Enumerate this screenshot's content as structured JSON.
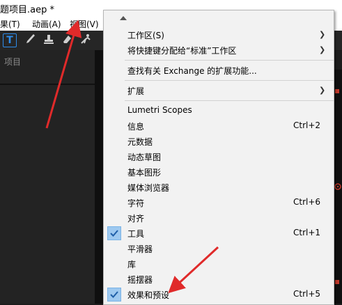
{
  "window": {
    "title": "题项目.aep *"
  },
  "menubar": {
    "items": [
      "果(T)",
      "动画(A)",
      "视图(V)"
    ]
  },
  "panel": {
    "title": "项目"
  },
  "menu": {
    "items": [
      {
        "label": "工作区(S)",
        "shortcut": "",
        "submenu": true,
        "checked": false
      },
      {
        "label": "将快捷键分配给“标准”工作区",
        "shortcut": "",
        "submenu": true,
        "checked": false
      },
      {
        "label": "查找有关 Exchange 的扩展功能...",
        "shortcut": "",
        "submenu": false,
        "checked": false
      },
      {
        "label": "扩展",
        "shortcut": "",
        "submenu": true,
        "checked": false
      },
      {
        "label": "Lumetri Scopes",
        "shortcut": "",
        "submenu": false,
        "checked": false
      },
      {
        "label": "信息",
        "shortcut": "Ctrl+2",
        "submenu": false,
        "checked": false
      },
      {
        "label": "元数据",
        "shortcut": "",
        "submenu": false,
        "checked": false
      },
      {
        "label": "动态草图",
        "shortcut": "",
        "submenu": false,
        "checked": false
      },
      {
        "label": "基本图形",
        "shortcut": "",
        "submenu": false,
        "checked": false
      },
      {
        "label": "媒体浏览器",
        "shortcut": "",
        "submenu": false,
        "checked": false
      },
      {
        "label": "字符",
        "shortcut": "Ctrl+6",
        "submenu": false,
        "checked": false
      },
      {
        "label": "对齐",
        "shortcut": "",
        "submenu": false,
        "checked": false
      },
      {
        "label": "工具",
        "shortcut": "Ctrl+1",
        "submenu": false,
        "checked": true
      },
      {
        "label": "平滑器",
        "shortcut": "",
        "submenu": false,
        "checked": false
      },
      {
        "label": "库",
        "shortcut": "",
        "submenu": false,
        "checked": false
      },
      {
        "label": "摇摆器",
        "shortcut": "",
        "submenu": false,
        "checked": false
      },
      {
        "label": "效果和预设",
        "shortcut": "Ctrl+5",
        "submenu": false,
        "checked": true
      }
    ]
  },
  "icons": {
    "toolbar": [
      "text-tool-icon",
      "brush-tool-icon",
      "clone-stamp-icon",
      "eraser-icon",
      "puppet-pin-icon"
    ],
    "menu_scroll": "scroll-up-arrow-icon",
    "check": "checkmark-icon",
    "submenu": "chevron-right-icon"
  },
  "colors": {
    "accent": "#2d8ceb",
    "check_bg": "#9ec9f0",
    "annotation": "#e02a2a",
    "menu_bg": "#f2f2f2",
    "app_bg": "#1d1d1d"
  }
}
